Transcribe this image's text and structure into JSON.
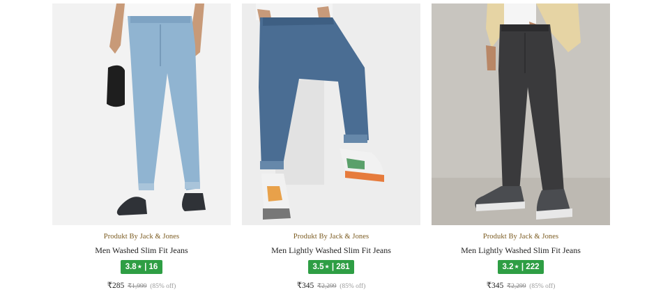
{
  "products": [
    {
      "brand": "Produkt By Jack & Jones",
      "title": "Men Washed Slim Fit Jeans",
      "rating": "3.8",
      "rating_count": "16",
      "price": "₹285",
      "mrp": "₹1,999",
      "discount": "(85% off)",
      "jeans_color": "#8fb3d0",
      "bg_color": "#f3f3f3"
    },
    {
      "brand": "Produkt By Jack & Jones",
      "title": "Men Lightly Washed Slim Fit Jeans",
      "rating": "3.5",
      "rating_count": "281",
      "price": "₹345",
      "mrp": "₹2,299",
      "discount": "(85% off)",
      "jeans_color": "#4a6d93",
      "bg_color": "#ececec"
    },
    {
      "brand": "Produkt By Jack & Jones",
      "title": "Men Lightly Washed Slim Fit Jeans",
      "rating": "3.2",
      "rating_count": "222",
      "price": "₹345",
      "mrp": "₹2,299",
      "discount": "(85% off)",
      "jeans_color": "#3a3a3c",
      "bg_color": "#c9c6c0"
    }
  ],
  "rating_star": "★",
  "rating_separator": "|",
  "colors": {
    "brand_text": "#7a5a1f",
    "rating_badge": "#2e9e44"
  }
}
